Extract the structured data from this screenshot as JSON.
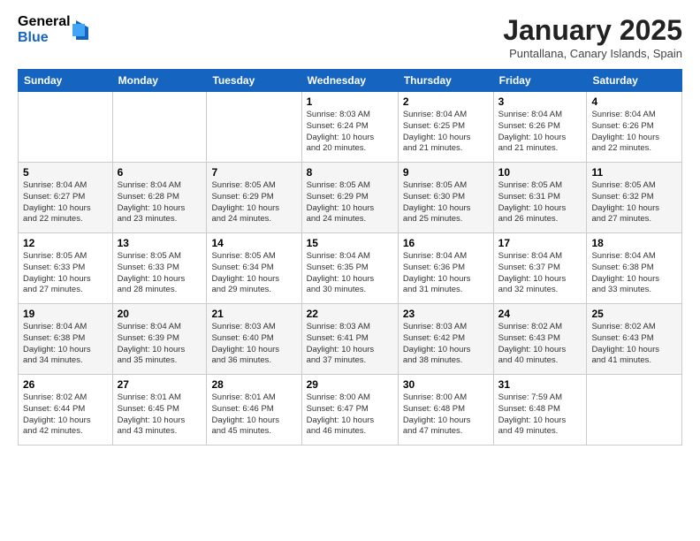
{
  "header": {
    "logo_general": "General",
    "logo_blue": "Blue",
    "month_title": "January 2025",
    "subtitle": "Puntallana, Canary Islands, Spain"
  },
  "weekdays": [
    "Sunday",
    "Monday",
    "Tuesday",
    "Wednesday",
    "Thursday",
    "Friday",
    "Saturday"
  ],
  "weeks": [
    [
      {
        "day": "",
        "info": ""
      },
      {
        "day": "",
        "info": ""
      },
      {
        "day": "",
        "info": ""
      },
      {
        "day": "1",
        "info": "Sunrise: 8:03 AM\nSunset: 6:24 PM\nDaylight: 10 hours\nand 20 minutes."
      },
      {
        "day": "2",
        "info": "Sunrise: 8:04 AM\nSunset: 6:25 PM\nDaylight: 10 hours\nand 21 minutes."
      },
      {
        "day": "3",
        "info": "Sunrise: 8:04 AM\nSunset: 6:26 PM\nDaylight: 10 hours\nand 21 minutes."
      },
      {
        "day": "4",
        "info": "Sunrise: 8:04 AM\nSunset: 6:26 PM\nDaylight: 10 hours\nand 22 minutes."
      }
    ],
    [
      {
        "day": "5",
        "info": "Sunrise: 8:04 AM\nSunset: 6:27 PM\nDaylight: 10 hours\nand 22 minutes."
      },
      {
        "day": "6",
        "info": "Sunrise: 8:04 AM\nSunset: 6:28 PM\nDaylight: 10 hours\nand 23 minutes."
      },
      {
        "day": "7",
        "info": "Sunrise: 8:05 AM\nSunset: 6:29 PM\nDaylight: 10 hours\nand 24 minutes."
      },
      {
        "day": "8",
        "info": "Sunrise: 8:05 AM\nSunset: 6:29 PM\nDaylight: 10 hours\nand 24 minutes."
      },
      {
        "day": "9",
        "info": "Sunrise: 8:05 AM\nSunset: 6:30 PM\nDaylight: 10 hours\nand 25 minutes."
      },
      {
        "day": "10",
        "info": "Sunrise: 8:05 AM\nSunset: 6:31 PM\nDaylight: 10 hours\nand 26 minutes."
      },
      {
        "day": "11",
        "info": "Sunrise: 8:05 AM\nSunset: 6:32 PM\nDaylight: 10 hours\nand 27 minutes."
      }
    ],
    [
      {
        "day": "12",
        "info": "Sunrise: 8:05 AM\nSunset: 6:33 PM\nDaylight: 10 hours\nand 27 minutes."
      },
      {
        "day": "13",
        "info": "Sunrise: 8:05 AM\nSunset: 6:33 PM\nDaylight: 10 hours\nand 28 minutes."
      },
      {
        "day": "14",
        "info": "Sunrise: 8:05 AM\nSunset: 6:34 PM\nDaylight: 10 hours\nand 29 minutes."
      },
      {
        "day": "15",
        "info": "Sunrise: 8:04 AM\nSunset: 6:35 PM\nDaylight: 10 hours\nand 30 minutes."
      },
      {
        "day": "16",
        "info": "Sunrise: 8:04 AM\nSunset: 6:36 PM\nDaylight: 10 hours\nand 31 minutes."
      },
      {
        "day": "17",
        "info": "Sunrise: 8:04 AM\nSunset: 6:37 PM\nDaylight: 10 hours\nand 32 minutes."
      },
      {
        "day": "18",
        "info": "Sunrise: 8:04 AM\nSunset: 6:38 PM\nDaylight: 10 hours\nand 33 minutes."
      }
    ],
    [
      {
        "day": "19",
        "info": "Sunrise: 8:04 AM\nSunset: 6:38 PM\nDaylight: 10 hours\nand 34 minutes."
      },
      {
        "day": "20",
        "info": "Sunrise: 8:04 AM\nSunset: 6:39 PM\nDaylight: 10 hours\nand 35 minutes."
      },
      {
        "day": "21",
        "info": "Sunrise: 8:03 AM\nSunset: 6:40 PM\nDaylight: 10 hours\nand 36 minutes."
      },
      {
        "day": "22",
        "info": "Sunrise: 8:03 AM\nSunset: 6:41 PM\nDaylight: 10 hours\nand 37 minutes."
      },
      {
        "day": "23",
        "info": "Sunrise: 8:03 AM\nSunset: 6:42 PM\nDaylight: 10 hours\nand 38 minutes."
      },
      {
        "day": "24",
        "info": "Sunrise: 8:02 AM\nSunset: 6:43 PM\nDaylight: 10 hours\nand 40 minutes."
      },
      {
        "day": "25",
        "info": "Sunrise: 8:02 AM\nSunset: 6:43 PM\nDaylight: 10 hours\nand 41 minutes."
      }
    ],
    [
      {
        "day": "26",
        "info": "Sunrise: 8:02 AM\nSunset: 6:44 PM\nDaylight: 10 hours\nand 42 minutes."
      },
      {
        "day": "27",
        "info": "Sunrise: 8:01 AM\nSunset: 6:45 PM\nDaylight: 10 hours\nand 43 minutes."
      },
      {
        "day": "28",
        "info": "Sunrise: 8:01 AM\nSunset: 6:46 PM\nDaylight: 10 hours\nand 45 minutes."
      },
      {
        "day": "29",
        "info": "Sunrise: 8:00 AM\nSunset: 6:47 PM\nDaylight: 10 hours\nand 46 minutes."
      },
      {
        "day": "30",
        "info": "Sunrise: 8:00 AM\nSunset: 6:48 PM\nDaylight: 10 hours\nand 47 minutes."
      },
      {
        "day": "31",
        "info": "Sunrise: 7:59 AM\nSunset: 6:48 PM\nDaylight: 10 hours\nand 49 minutes."
      },
      {
        "day": "",
        "info": ""
      }
    ]
  ]
}
